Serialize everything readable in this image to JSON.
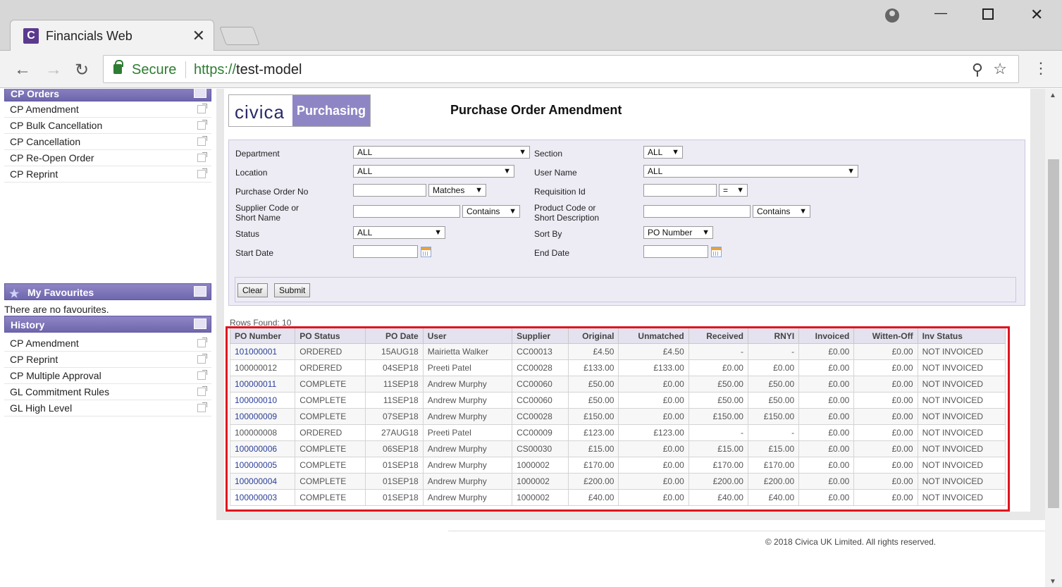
{
  "browser": {
    "tab_title": "Financials Web",
    "tab_favicon": "C",
    "tab_close": "✕",
    "secure_label": "Secure",
    "url_scheme": "https://",
    "url_host": "test-model",
    "icons": [
      "back-icon",
      "forward-icon",
      "reload-icon",
      "lock-icon",
      "zoom-icon",
      "star-icon",
      "menu-icon",
      "profile-icon",
      "minimize-icon",
      "maximize-icon",
      "close-icon"
    ]
  },
  "sidebar": {
    "cp_orders": {
      "title": "CP Orders",
      "items": [
        "CP Amendment",
        "CP Bulk Cancellation",
        "CP Cancellation",
        "CP Re-Open Order",
        "CP Reprint"
      ]
    },
    "favourites": {
      "title": "My Favourites",
      "empty_text": "There are no favourites."
    },
    "history": {
      "title": "History",
      "items": [
        "CP Amendment",
        "CP Reprint",
        "CP Multiple Approval",
        "GL Commitment Rules",
        "GL High Level"
      ]
    }
  },
  "header": {
    "logo_civica": "civica",
    "logo_purchasing": "Purchasing",
    "title": "Purchase Order Amendment"
  },
  "filter": {
    "department_label": "Department",
    "department_value": "ALL",
    "section_label": "Section",
    "section_value": "ALL",
    "location_label": "Location",
    "location_value": "ALL",
    "user_name_label": "User Name",
    "user_name_value": "ALL",
    "po_no_label": "Purchase Order No",
    "po_no_match": "Matches",
    "req_id_label": "Requisition Id",
    "req_id_match": "=",
    "supplier_label_1": "Supplier Code or",
    "supplier_label_2": "Short Name",
    "supplier_match": "Contains",
    "product_label_1": "Product Code or",
    "product_label_2": "Short Description",
    "product_match": "Contains",
    "status_label": "Status",
    "status_value": "ALL",
    "sort_label": "Sort By",
    "sort_value": "PO Number",
    "start_label": "Start Date",
    "end_label": "End Date",
    "clear_label": "Clear",
    "submit_label": "Submit"
  },
  "results": {
    "rows_found": "Rows Found: 10",
    "columns": [
      "PO Number",
      "PO Status",
      "PO Date",
      "User",
      "Supplier",
      "Original",
      "Unmatched",
      "Received",
      "RNYI",
      "Invoiced",
      "Witten-Off",
      "Inv Status"
    ],
    "rows": [
      [
        "101000001",
        "ORDERED",
        "15AUG18",
        "Mairietta Walker",
        "CC00013",
        "£4.50",
        "£4.50",
        "-",
        "-",
        "£0.00",
        "£0.00",
        "NOT INVOICED"
      ],
      [
        "100000012",
        "ORDERED",
        "04SEP18",
        "Preeti Patel",
        "CC00028",
        "£133.00",
        "£133.00",
        "£0.00",
        "£0.00",
        "£0.00",
        "£0.00",
        "NOT INVOICED"
      ],
      [
        "100000011",
        "COMPLETE",
        "11SEP18",
        "Andrew Murphy",
        "CC00060",
        "£50.00",
        "£0.00",
        "£50.00",
        "£50.00",
        "£0.00",
        "£0.00",
        "NOT INVOICED"
      ],
      [
        "100000010",
        "COMPLETE",
        "11SEP18",
        "Andrew Murphy",
        "CC00060",
        "£50.00",
        "£0.00",
        "£50.00",
        "£50.00",
        "£0.00",
        "£0.00",
        "NOT INVOICED"
      ],
      [
        "100000009",
        "COMPLETE",
        "07SEP18",
        "Andrew Murphy",
        "CC00028",
        "£150.00",
        "£0.00",
        "£150.00",
        "£150.00",
        "£0.00",
        "£0.00",
        "NOT INVOICED"
      ],
      [
        "100000008",
        "ORDERED",
        "27AUG18",
        "Preeti Patel",
        "CC00009",
        "£123.00",
        "£123.00",
        "-",
        "-",
        "£0.00",
        "£0.00",
        "NOT INVOICED"
      ],
      [
        "100000006",
        "COMPLETE",
        "06SEP18",
        "Andrew Murphy",
        "CS00030",
        "£15.00",
        "£0.00",
        "£15.00",
        "£15.00",
        "£0.00",
        "£0.00",
        "NOT INVOICED"
      ],
      [
        "100000005",
        "COMPLETE",
        "01SEP18",
        "Andrew Murphy",
        "1000002",
        "£170.00",
        "£0.00",
        "£170.00",
        "£170.00",
        "£0.00",
        "£0.00",
        "NOT INVOICED"
      ],
      [
        "100000004",
        "COMPLETE",
        "01SEP18",
        "Andrew Murphy",
        "1000002",
        "£200.00",
        "£0.00",
        "£200.00",
        "£200.00",
        "£0.00",
        "£0.00",
        "NOT INVOICED"
      ],
      [
        "100000003",
        "COMPLETE",
        "01SEP18",
        "Andrew Murphy",
        "1000002",
        "£40.00",
        "£0.00",
        "£40.00",
        "£40.00",
        "£0.00",
        "£0.00",
        "NOT INVOICED"
      ]
    ],
    "linked_rows": [
      0,
      2,
      3,
      4,
      6,
      7,
      8,
      9
    ],
    "highlight_color": "#e0141e"
  },
  "footer": {
    "copyright": "© 2018 Civica UK Limited. All rights reserved."
  }
}
